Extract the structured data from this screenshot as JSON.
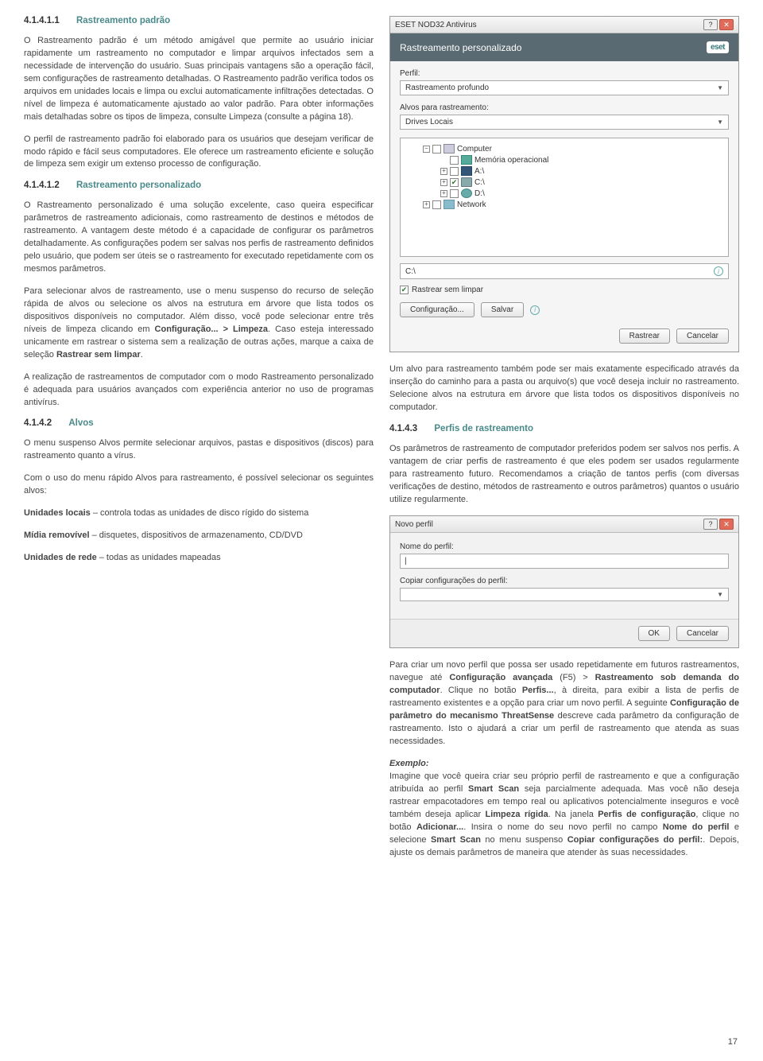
{
  "left": {
    "s1": {
      "num": "4.1.4.1.1",
      "title": "Rastreamento padrão"
    },
    "p1": "O Rastreamento padrão é um método amigável que permite ao usuário iniciar rapidamente um rastreamento no computador e limpar arquivos infectados sem a necessidade de intervenção do usuário. Suas principais vantagens são a operação fácil, sem configurações de rastreamento detalhadas. O Rastreamento padrão verifica todos os arquivos em unidades locais e limpa ou exclui automaticamente infiltrações detectadas. O nível de limpeza é automaticamente ajustado ao valor padrão. Para obter informações mais detalhadas sobre os tipos de limpeza, consulte Limpeza (consulte a página 18).",
    "p2": "O perfil de rastreamento padrão foi elaborado para os usuários que desejam verificar de modo rápido e fácil seus computadores. Ele oferece um rastreamento eficiente e solução de limpeza sem exigir um extenso processo de configuração.",
    "s2": {
      "num": "4.1.4.1.2",
      "title": "Rastreamento personalizado"
    },
    "p3": "O Rastreamento personalizado é uma solução excelente, caso queira especificar parâmetros de rastreamento adicionais, como rastreamento de destinos e métodos de rastreamento. A vantagem deste método é a capacidade de configurar os parâmetros detalhadamente. As configurações podem ser salvas nos perfis de rastreamento definidos pelo usuário, que podem ser úteis se o rastreamento for executado repetidamente com os mesmos parâmetros.",
    "p4a": "Para selecionar alvos de rastreamento, use o menu suspenso do recurso de seleção rápida de alvos ou selecione os alvos na estrutura em árvore que lista todos os dispositivos disponíveis no computador. Além disso, você pode selecionar entre três níveis de limpeza clicando em ",
    "p4b": "Configuração... > Limpeza",
    "p4c": ". Caso esteja interessado unicamente em rastrear o sistema sem a realização de outras ações, marque a caixa de seleção ",
    "p4d": "Rastrear sem limpar",
    "p4e": ".",
    "p5": "A realização de rastreamentos de computador com o modo Rastreamento personalizado é adequada para usuários avançados com experiência anterior no uso de programas antivírus.",
    "s3": {
      "num": "4.1.4.2",
      "title": "Alvos"
    },
    "p6": "O menu suspenso Alvos permite selecionar arquivos, pastas e dispositivos (discos) para rastreamento quanto a vírus.",
    "p7": "Com o uso do menu rápido Alvos para rastreamento, é possível selecionar os seguintes alvos:",
    "p8a": "Unidades locais",
    "p8b": " – controla todas as unidades de disco rígido do sistema",
    "p9a": "Mídia removível",
    "p9b": " – disquetes, dispositivos de armazenamento, CD/DVD",
    "p10a": "Unidades de rede",
    "p10b": " – todas as unidades mapeadas"
  },
  "win1": {
    "title": "ESET NOD32 Antivirus",
    "header": "Rastreamento personalizado",
    "logo": "eset",
    "perfil_label": "Perfil:",
    "perfil_value": "Rastreamento profundo",
    "alvos_label": "Alvos para rastreamento:",
    "alvos_value": "Drives Locais",
    "tree": {
      "computer": "Computer",
      "mem": "Memória operacional",
      "a": "A:\\",
      "c": "C:\\",
      "d": "D:\\",
      "net": "Network"
    },
    "path_value": "C:\\",
    "check_label": "Rastrear sem limpar",
    "btn_config": "Configuração...",
    "btn_save": "Salvar",
    "btn_scan": "Rastrear",
    "btn_cancel": "Cancelar"
  },
  "right": {
    "p1": "Um alvo para rastreamento também pode ser mais exatamente especificado através da inserção do caminho para a pasta ou arquivo(s) que você deseja incluir no rastreamento. Selecione alvos na estrutura em árvore que lista todos os dispositivos disponíveis no computador.",
    "s1": {
      "num": "4.1.4.3",
      "title": "Perfis de rastreamento"
    },
    "p2": "Os parâmetros de rastreamento de computador preferidos podem ser salvos nos perfis. A vantagem de criar perfis de rastreamento é que eles podem ser usados regularmente para rastreamento futuro. Recomendamos a criação de tantos perfis (com diversas verificações de destino, métodos de rastreamento e outros parâmetros) quantos o usuário utilize regularmente.",
    "p3a": "Para criar um novo perfil que possa ser usado repetidamente em futuros rastreamentos, navegue até ",
    "p3b": "Configuração avançada",
    "p3c": " (F5) > ",
    "p3d": "Rastreamento sob demanda do computador",
    "p3e": ". Clique no botão ",
    "p3f": "Perfis...",
    "p3g": ", à direita, para exibir a lista de perfis de rastreamento existentes e a opção para criar um novo perfil. A seguinte ",
    "p3h": "Configuração de parâmetro do mecanismo ThreatSense",
    "p3i": " descreve cada parâmetro da configuração de rastreamento. Isto o ajudará a criar um perfil de rastreamento que atenda as suas necessidades.",
    "ex_label": "Exemplo:",
    "p4a": "Imagine que você queira criar seu próprio perfil de rastreamento e que a configuração atribuída ao perfil ",
    "p4b": "Smart Scan",
    "p4c": " seja parcialmente adequada. Mas você não deseja rastrear empacotadores em tempo real ou aplicativos potencialmente inseguros e você também deseja aplicar ",
    "p4d": "Limpeza rígida",
    "p4e": ". Na janela ",
    "p4f": "Perfis de configuração",
    "p4g": ", clique no botão ",
    "p4h": "Adicionar...",
    "p4i": ". Insira o nome do seu novo perfil no campo ",
    "p4j": "Nome do perfil",
    "p4k": " e selecione ",
    "p4l": "Smart Scan",
    "p4m": " no menu suspenso ",
    "p4n": "Copiar configurações do perfil:",
    "p4o": ". Depois, ajuste os demais parâmetros de maneira que atender às suas necessidades."
  },
  "win2": {
    "title": "Novo perfil",
    "name_label": "Nome do perfil:",
    "copy_label": "Copiar configurações do perfil:",
    "ok": "OK",
    "cancel": "Cancelar"
  },
  "page_number": "17"
}
